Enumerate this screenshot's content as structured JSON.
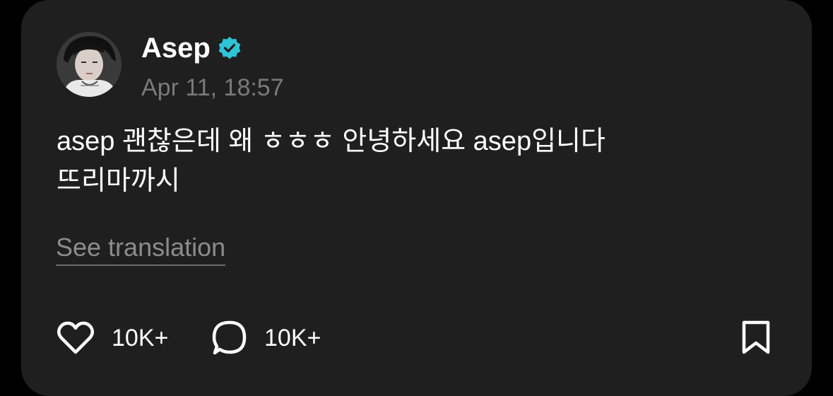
{
  "post": {
    "author": "Asep",
    "verified_icon": "verified-check-icon",
    "verified_color": "#2ec4d6",
    "timestamp": "Apr 11, 18:57",
    "text_line_1": "asep 괜찮은데 왜 ㅎㅎㅎ 안녕하세요 asep입니다",
    "text_line_2": "뜨리마까시",
    "see_translation": "See translation"
  },
  "actions": {
    "like_icon": "heart-icon",
    "like_count": "10K+",
    "reply_icon": "speech-bubble-icon",
    "reply_count": "10K+",
    "bookmark_icon": "bookmark-icon"
  },
  "colors": {
    "background": "#000000",
    "card": "#1f1f1f",
    "muted_text": "#7a7a7a"
  }
}
